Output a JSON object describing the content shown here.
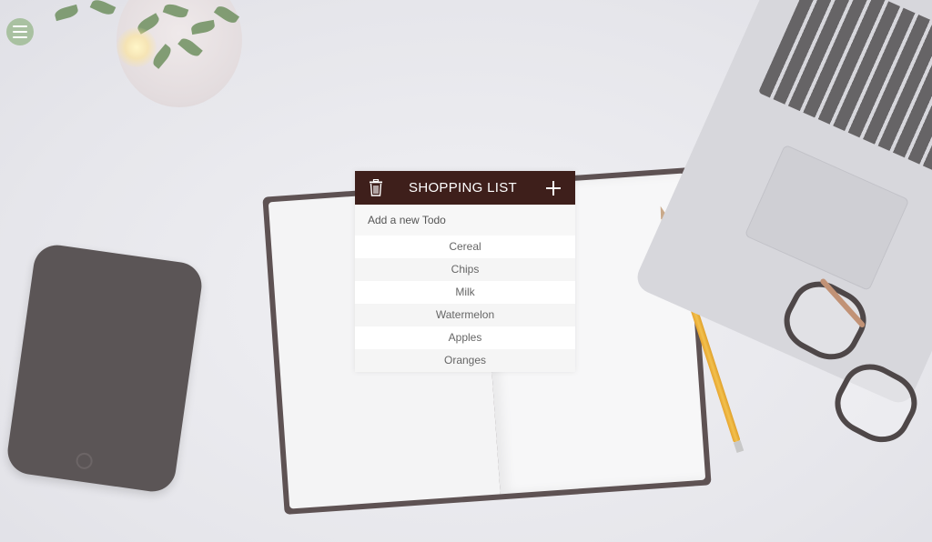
{
  "menu": {
    "icon": "hamburger-menu-icon"
  },
  "todo": {
    "title": "SHOPPING LIST",
    "trash_icon": "trash-icon",
    "add_icon": "plus-icon",
    "input_placeholder": "Add a new Todo",
    "input_value": "",
    "items": [
      {
        "label": "Cereal"
      },
      {
        "label": "Chips"
      },
      {
        "label": "Milk"
      },
      {
        "label": "Watermelon"
      },
      {
        "label": "Apples"
      },
      {
        "label": "Oranges"
      }
    ]
  },
  "colors": {
    "header_bg": "#3e1f1b",
    "menu_button_bg": "#a9c1a1",
    "item_text": "#666666"
  }
}
